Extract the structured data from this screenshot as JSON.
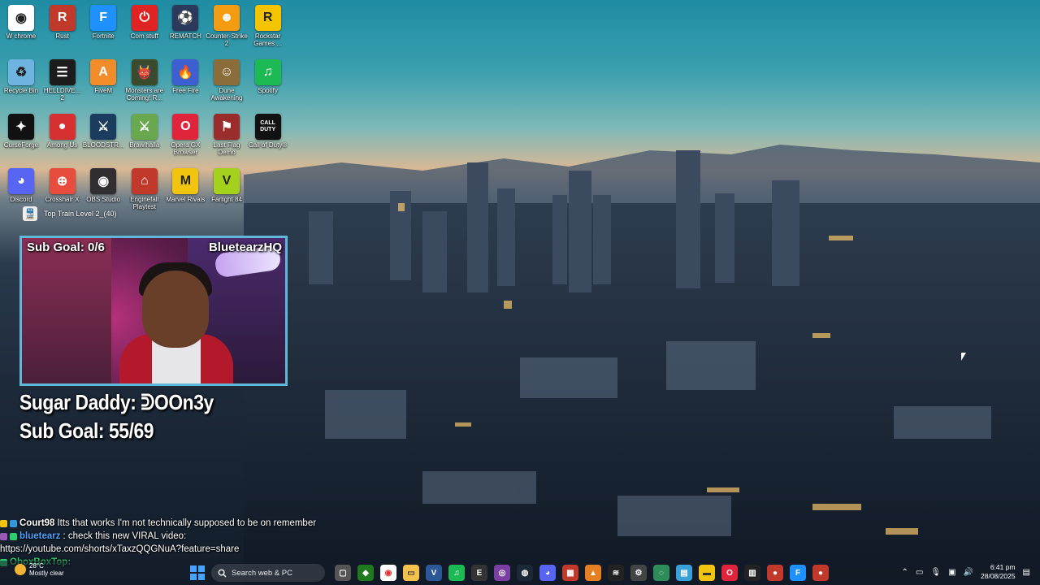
{
  "desktop": {
    "icons": [
      {
        "label": "W chrome",
        "color": "#ffffff",
        "icon": "chrome-icon"
      },
      {
        "label": "Rust",
        "color": "#c0392b",
        "icon": "rust-icon"
      },
      {
        "label": "Fortnite",
        "color": "#1e90ff",
        "icon": "fortnite-icon"
      },
      {
        "label": "Com stuff",
        "color": "#e02424",
        "icon": "power-icon"
      },
      {
        "label": "REMATCH",
        "color": "#2b3a5c",
        "icon": "rematch-icon"
      },
      {
        "label": "Counter-Strike 2",
        "color": "#f39c12",
        "icon": "counter-strike-icon"
      },
      {
        "label": "Rockstar Games ...",
        "color": "#f5c400",
        "icon": "rockstar-icon"
      },
      {
        "label": "Recycle Bin",
        "color": "#6fb3e0",
        "icon": "recycle-bin-icon"
      },
      {
        "label": "HELLDIVE... 2",
        "color": "#1c1c1c",
        "icon": "helldivers-icon"
      },
      {
        "label": "FiveM",
        "color": "#f28c28",
        "icon": "fivem-icon"
      },
      {
        "label": "Monsters are Coming! R...",
        "color": "#3c4a2c",
        "icon": "monsters-icon"
      },
      {
        "label": "Free Fire",
        "color": "#3d5fd1",
        "icon": "free-fire-icon"
      },
      {
        "label": "Dune Awakening",
        "color": "#8a6d3b",
        "icon": "dune-icon"
      },
      {
        "label": "Spotify",
        "color": "#1db954",
        "icon": "spotify-icon"
      },
      {
        "label": "CurseForge",
        "color": "#111111",
        "icon": "curseforge-icon"
      },
      {
        "label": "Among Us",
        "color": "#d63031",
        "icon": "among-us-icon"
      },
      {
        "label": "BLOODSTR...",
        "color": "#1b3c5e",
        "icon": "bloodstrike-icon"
      },
      {
        "label": "Brawlhalla",
        "color": "#6aa84f",
        "icon": "brawlhalla-icon"
      },
      {
        "label": "Opera GX Browser",
        "color": "#e0243b",
        "icon": "opera-gx-icon"
      },
      {
        "label": "Last Flag Demo",
        "color": "#9b2c2c",
        "icon": "last-flag-icon"
      },
      {
        "label": "Call of Duty®",
        "color": "#111111",
        "icon": "call-of-duty-icon"
      },
      {
        "label": "Discord",
        "color": "#5865f2",
        "icon": "discord-icon"
      },
      {
        "label": "Crosshair X",
        "color": "#e74c3c",
        "icon": "crosshair-icon"
      },
      {
        "label": "OBS Studio",
        "color": "#302e31",
        "icon": "obs-icon"
      },
      {
        "label": "Enginefall Playtest",
        "color": "#c0392b",
        "icon": "enginefall-icon"
      },
      {
        "label": "Marvel Rivals",
        "color": "#f1c40f",
        "icon": "marvel-rivals-icon"
      },
      {
        "label": "Farlight 84",
        "color": "#a4d11c",
        "icon": "farlight-icon"
      }
    ],
    "glyphs": [
      "◉",
      "R",
      "F",
      "⏻",
      "⚽",
      "☻",
      "R",
      "♻",
      "☰",
      "A",
      "👹",
      "🔥",
      "☺",
      "♫",
      "✦",
      "●",
      "⚔",
      "⚔",
      "O",
      "⚑",
      "CALL DUTY",
      "◕",
      "⊕",
      "◉",
      "⌂",
      "M",
      "V"
    ],
    "train": {
      "label": "Top Train Level 2_(40)"
    }
  },
  "overlay": {
    "cam_goal": "Sub Goal: 0/6",
    "cam_channel": "BluetearzHQ",
    "goal_line1": "Sugar Daddy: ᕲOOn3y",
    "goal_line2": "Sub Goal: 55/69"
  },
  "chat": [
    {
      "user": "Court98",
      "message": " Itts that works I'm not technically supposed to be on remember"
    },
    {
      "user": "bluetearz",
      "message": ": check this new VIRAL video:"
    },
    {
      "user": "",
      "message": "https://youtube.com/shorts/xTaxzQQGNuA?feature=share"
    },
    {
      "user": "OboxBoxTop:",
      "message": ""
    }
  ],
  "taskbar": {
    "weather_temp": "28°C",
    "weather_desc": "Mostly clear",
    "search_placeholder": "Search web & PC",
    "time": "6:41 pm",
    "date": "28/08/2025"
  }
}
